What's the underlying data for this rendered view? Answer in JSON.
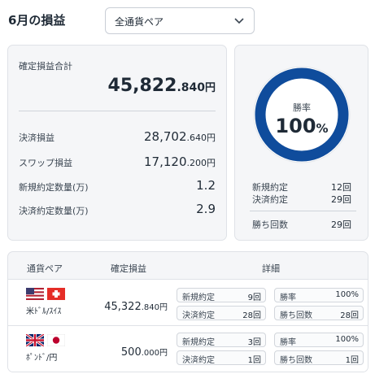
{
  "header": {
    "title": "6月の損益",
    "select_value": "全通貨ペア"
  },
  "summary": {
    "total_label": "確定損益合計",
    "total_int": "45,822",
    "total_dec": ".840",
    "yen": "円",
    "settlement_label": "決済損益",
    "settlement_int": "28,702",
    "settlement_dec": ".640",
    "swap_label": "スワップ損益",
    "swap_int": "17,120",
    "swap_dec": ".200",
    "new_qty_label": "新規約定数量(万)",
    "new_qty_value": "1.2",
    "close_qty_label": "決済約定数量(万)",
    "close_qty_value": "2.9"
  },
  "win": {
    "rate_label": "勝率",
    "rate_value": "100",
    "rate_unit": "%",
    "rate_fraction": 1.0,
    "ring_color": "#0f4c9c",
    "new_label": "新規約定",
    "new_value": "12回",
    "close_label": "決済約定",
    "close_value": "29回",
    "wins_label": "勝ち回数",
    "wins_value": "29回"
  },
  "table": {
    "col_pair": "通貨ペア",
    "col_profit": "確定損益",
    "col_detail": "詳細",
    "rows": [
      {
        "pair": "米ﾄﾞﾙ/ｽｲｽ",
        "flag1": "us-flag-icon",
        "flag2": "swiss-flag-icon",
        "profit_int": "45,322",
        "profit_dec": ".840",
        "yen": "円",
        "new_label": "新規約定",
        "new_value": "9回",
        "close_label": "決済約定",
        "close_value": "28回",
        "rate_label": "勝率",
        "rate_value": "100%",
        "wins_label": "勝ち回数",
        "wins_value": "28回"
      },
      {
        "pair": "ﾎﾟﾝﾄﾞ/円",
        "flag1": "uk-flag-icon",
        "flag2": "japan-flag-icon",
        "profit_int": "500",
        "profit_dec": ".000",
        "yen": "円",
        "new_label": "新規約定",
        "new_value": "3回",
        "close_label": "決済約定",
        "close_value": "1回",
        "rate_label": "勝率",
        "rate_value": "100%",
        "wins_label": "勝ち回数",
        "wins_value": "1回"
      }
    ]
  }
}
